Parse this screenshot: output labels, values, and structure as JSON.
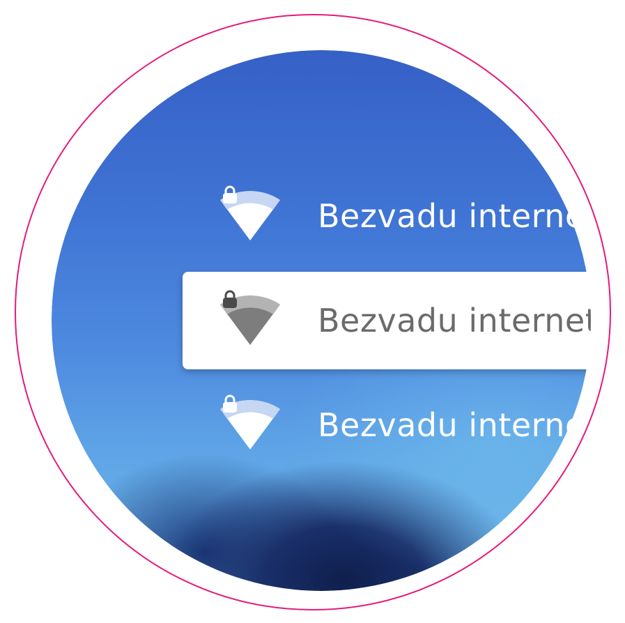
{
  "networks": [
    {
      "name": "Bezvadu internets",
      "selected": false,
      "secured": true,
      "icon": "wifi-locked-icon"
    },
    {
      "name": "Bezvadu internets",
      "selected": true,
      "secured": true,
      "icon": "wifi-locked-icon"
    },
    {
      "name": "Bezvadu internets",
      "selected": false,
      "secured": true,
      "icon": "wifi-locked-icon"
    }
  ],
  "colors": {
    "ring": "#e5197a",
    "highlight": "#ffffff",
    "selected_text": "#6b6b6b",
    "unselected_text": "#ffffff",
    "wallpaper_top": "#3660c6",
    "wallpaper_bottom": "#6fbbea"
  }
}
